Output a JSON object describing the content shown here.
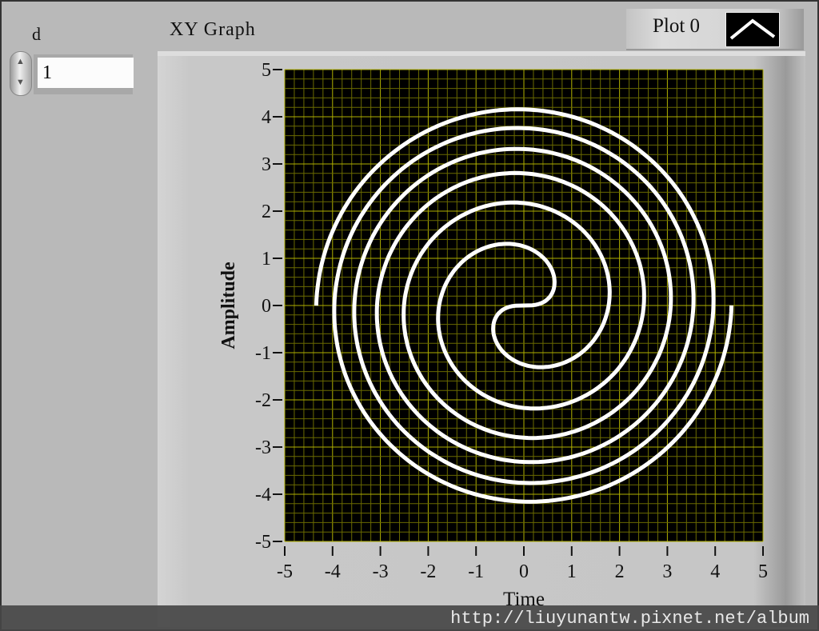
{
  "control": {
    "label": "d",
    "value": "1"
  },
  "graph": {
    "title": "XY Graph",
    "legend_plot_name": "Plot 0"
  },
  "watermark": "http://liuyunantw.pixnet.net/album",
  "colors": {
    "plot_bg": "#000000",
    "grid": "#8a8a00",
    "trace": "#ffffff",
    "panel": "#b9b9b9"
  },
  "chart_data": {
    "type": "line",
    "title": "XY Graph",
    "xlabel": "Time",
    "ylabel": "Amplitude",
    "xlim": [
      -5,
      5
    ],
    "ylim": [
      -5,
      5
    ],
    "xticks": [
      "-5",
      "-4",
      "-3",
      "-2",
      "-1",
      "0",
      "1",
      "2",
      "3",
      "4",
      "5"
    ],
    "yticks": [
      "5",
      "4",
      "3",
      "2",
      "1",
      "0",
      "-1",
      "-2",
      "-3",
      "-4",
      "-5"
    ],
    "grid": true,
    "minor_grid_step": 0.2,
    "series": [
      {
        "name": "Plot 0",
        "description": "Fermat spiral, both arms",
        "r_formula": "r = sqrt(theta)",
        "theta_range": [
          0,
          18.85
        ],
        "arms": 2
      }
    ],
    "legend": "top-right"
  }
}
